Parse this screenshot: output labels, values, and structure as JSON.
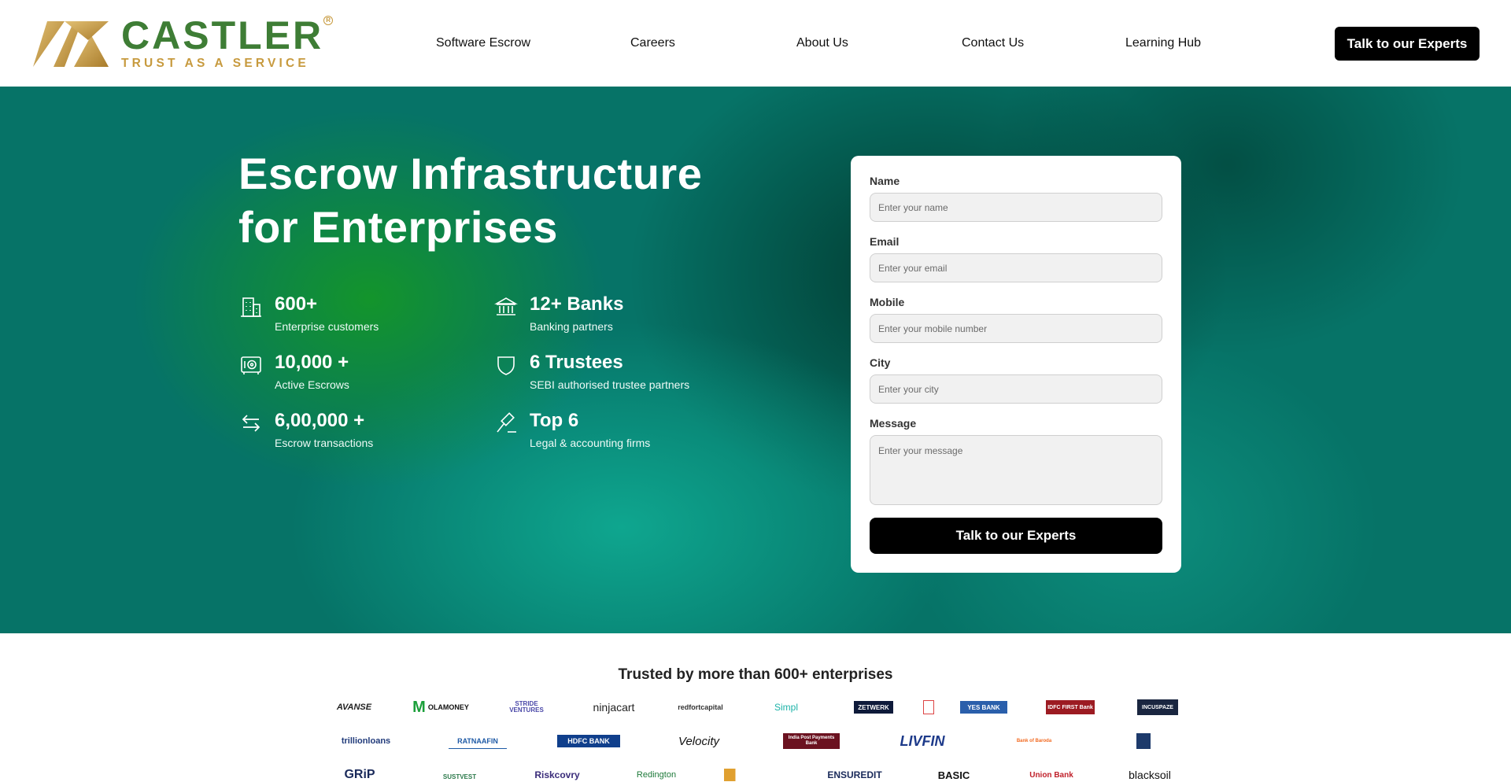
{
  "header": {
    "brand_name": "CASTLER",
    "brand_tagline": "TRUST AS A SERVICE",
    "brand_reg": "R",
    "nav": [
      {
        "label": "Software Escrow"
      },
      {
        "label": "Careers"
      },
      {
        "label": "About Us"
      },
      {
        "label": "Contact Us"
      },
      {
        "label": "Learning Hub"
      }
    ],
    "cta_label": "Talk to our Experts"
  },
  "hero": {
    "title_line1": "Escrow Infrastructure",
    "title_line2": "for Enterprises",
    "stats": [
      {
        "value": "600+",
        "label": "Enterprise customers",
        "icon": "building-icon"
      },
      {
        "value": "12+ Banks",
        "label": "Banking partners",
        "icon": "bank-icon"
      },
      {
        "value": "10,000 +",
        "label": "Active Escrows",
        "icon": "safe-icon"
      },
      {
        "value": "6 Trustees",
        "label": "SEBI authorised trustee partners",
        "icon": "shield-icon"
      },
      {
        "value": "6,00,000 +",
        "label": "Escrow transactions",
        "icon": "transfer-arrows-icon"
      },
      {
        "value": "Top 6",
        "label": "Legal & accounting firms",
        "icon": "gavel-icon"
      }
    ]
  },
  "form": {
    "name_label": "Name",
    "name_placeholder": "Enter your name",
    "email_label": "Email",
    "email_placeholder": "Enter your email",
    "mobile_label": "Mobile",
    "mobile_placeholder": "Enter your mobile number",
    "city_label": "City",
    "city_placeholder": "Enter your city",
    "message_label": "Message",
    "message_placeholder": "Enter your message",
    "submit_label": "Talk to our Experts"
  },
  "trusted": {
    "title": "Trusted by more than 600+ enterprises",
    "row1": [
      "AVANSE",
      "OLAMONEY",
      "STRIDE VENTURES",
      "ninjacart",
      "redfortcapital",
      "Simpl",
      "ZETWERK",
      "",
      "YES BANK",
      "IDFC FIRST Bank",
      "INCUSPAZE"
    ],
    "row2": [
      "trillionloans",
      "RATNAAFIN",
      "HDFC BANK",
      "Velocity",
      "India Post Payments Bank",
      "LIVFIN",
      "Bank of Baroda",
      ""
    ],
    "row3": [
      "GRiP",
      "SUSTVEST",
      "Riskcovry",
      "Redington",
      "",
      "ENSUREDIT",
      "BASIC",
      "Union Bank",
      "blacksoil"
    ]
  },
  "colors": {
    "brand_green": "#3e7d35",
    "brand_gold": "#c79a3e",
    "hero_teal": "#067367",
    "cta_black": "#000000"
  }
}
